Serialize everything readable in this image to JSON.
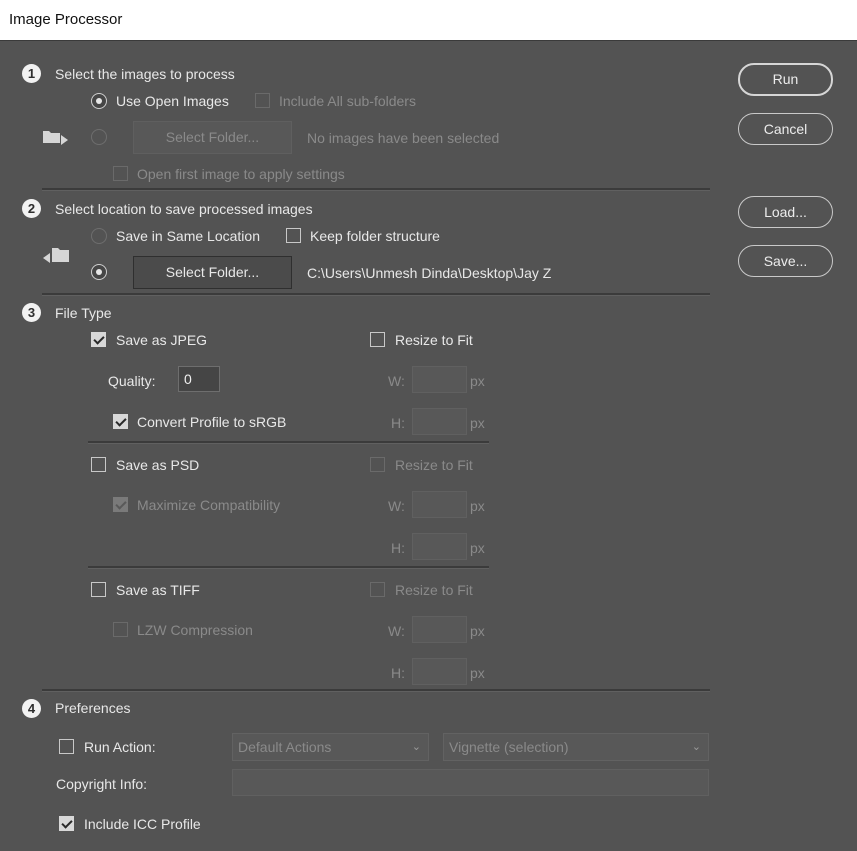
{
  "window": {
    "title": "Image Processor"
  },
  "buttons": {
    "run": "Run",
    "cancel": "Cancel",
    "load": "Load...",
    "save": "Save..."
  },
  "section1": {
    "number": "1",
    "title": "Select the images to process",
    "use_open_images": "Use Open Images",
    "include_subfolders": "Include All sub-folders",
    "select_folder": "Select Folder...",
    "no_images": "No images have been selected",
    "open_first_image": "Open first image to apply settings"
  },
  "section2": {
    "number": "2",
    "title": "Select location to save processed images",
    "same_location": "Save in Same Location",
    "keep_structure": "Keep folder structure",
    "select_folder": "Select Folder...",
    "path": "C:\\Users\\Unmesh Dinda\\Desktop\\Jay Z"
  },
  "section3": {
    "number": "3",
    "title": "File Type",
    "jpeg": {
      "label": "Save as JPEG",
      "checked": true,
      "quality_label": "Quality:",
      "quality_value": "0",
      "convert": "Convert Profile to sRGB",
      "convert_checked": true,
      "resize": "Resize to Fit",
      "w": "W:",
      "h": "H:",
      "px": "px"
    },
    "psd": {
      "label": "Save as PSD",
      "checked": false,
      "maximize": "Maximize Compatibility",
      "maximize_checked": true,
      "resize": "Resize to Fit",
      "w": "W:",
      "h": "H:",
      "px": "px"
    },
    "tiff": {
      "label": "Save as TIFF",
      "checked": false,
      "lzw": "LZW Compression",
      "lzw_checked": false,
      "resize": "Resize to Fit",
      "w": "W:",
      "h": "H:",
      "px": "px"
    }
  },
  "section4": {
    "number": "4",
    "title": "Preferences",
    "run_action": "Run Action:",
    "action_set": "Default Actions",
    "action": "Vignette (selection)",
    "copyright": "Copyright Info:",
    "copyright_value": "",
    "icc": "Include ICC Profile",
    "icc_checked": true
  },
  "icons": {
    "open_folder": "folder-arrow-icon",
    "save_folder": "folder-save-icon",
    "dropdown": "chevron-down-icon"
  }
}
